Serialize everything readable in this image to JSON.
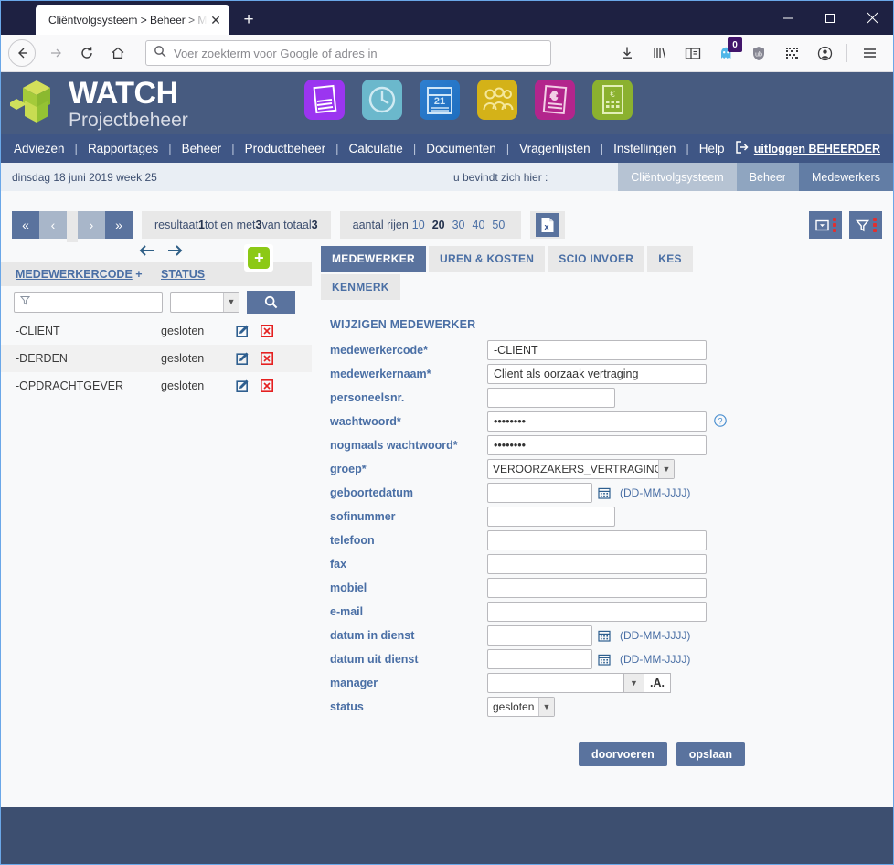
{
  "browser": {
    "tab_title": "Cliëntvolgsysteem > Beheer > Med",
    "close_tab": "✕",
    "new_tab": "+",
    "minimize": "—",
    "maximize": "▢",
    "close_window": "✕",
    "url_placeholder": "Voer zoekterm voor Google of adres in",
    "url_value": "",
    "container_badge": "0"
  },
  "brand": {
    "name": "WATCH",
    "subtitle": "Projectbeheer",
    "app_icons": [
      "documents-icon",
      "clock-icon",
      "calendar-21-icon",
      "people-icon",
      "euro-invoice-icon",
      "calculator-icon"
    ]
  },
  "menu": {
    "items": [
      "Adviezen",
      "Rapportages",
      "Beheer",
      "Productbeheer",
      "Calculatie",
      "Documenten",
      "Vragenlijsten",
      "Instellingen",
      "Help"
    ],
    "separator": "|",
    "logout_label": "uitloggen BEHEERDER"
  },
  "breadcrumb": {
    "date": "dinsdag 18 juni 2019   week 25",
    "here_label": "u bevindt zich hier :",
    "items": [
      "Cliëntvolgsysteem",
      "Beheer",
      "Medewerkers"
    ]
  },
  "toolbar": {
    "first": "«",
    "prev": "‹",
    "next": "›",
    "last": "»",
    "result_prefix": "resultaat ",
    "result_from": "1",
    "result_mid": " tot en met ",
    "result_to": "3",
    "result_suffix": " van totaal ",
    "result_total": "3",
    "rows_label": "aantal rijen",
    "row_options": [
      "10",
      "20",
      "30",
      "40",
      "50"
    ],
    "rows_selected": "20",
    "export_icon": "excel-export-icon",
    "columns_icon": "column-chooser-icon",
    "filter_icon": "filter-icon"
  },
  "list": {
    "move_left": "←",
    "move_right": "→",
    "add_label": "+",
    "columns": [
      "MEDEWERKERCODE",
      "STATUS"
    ],
    "sort_marker": "+",
    "filter_placeholder": "",
    "status_filter_value": "",
    "search_label": "search-icon",
    "rows": [
      {
        "code": "-CLIENT",
        "status": "gesloten"
      },
      {
        "code": "-DERDEN",
        "status": "gesloten"
      },
      {
        "code": "-OPDRACHTGEVER",
        "status": "gesloten"
      }
    ]
  },
  "form": {
    "tabs": [
      "MEDEWERKER",
      "UREN & KOSTEN",
      "SCIO INVOER",
      "KES",
      "KENMERK"
    ],
    "active_tab": "MEDEWERKER",
    "title": "WIJZIGEN MEDEWERKER",
    "date_hint": "(DD-MM-JJJJ)",
    "fields": [
      {
        "label": "medewerkercode*",
        "value": "-CLIENT"
      },
      {
        "label": "medewerkernaam*",
        "value": "Client als oorzaak vertraging"
      },
      {
        "label": "personeelsnr.",
        "value": ""
      },
      {
        "label": "wachtwoord*",
        "value": "••••••••"
      },
      {
        "label": "nogmaals wachtwoord*",
        "value": "••••••••"
      },
      {
        "label": "groep*",
        "value": "VEROORZAKERS_VERTRAGING"
      },
      {
        "label": "geboortedatum",
        "value": ""
      },
      {
        "label": "sofinummer",
        "value": ""
      },
      {
        "label": "telefoon",
        "value": ""
      },
      {
        "label": "fax",
        "value": ""
      },
      {
        "label": "mobiel",
        "value": ""
      },
      {
        "label": "e-mail",
        "value": ""
      },
      {
        "label": "datum in dienst",
        "value": ""
      },
      {
        "label": "datum uit dienst",
        "value": ""
      },
      {
        "label": "manager",
        "value": ""
      },
      {
        "label": "status",
        "value": "gesloten"
      }
    ],
    "manager_suffix": ".A.",
    "buttons": {
      "apply": "doorvoeren",
      "save": "opslaan"
    }
  },
  "colors": {
    "titlebar": "#1e2142",
    "brandbar": "#475b80",
    "menubar": "#3f5685",
    "accent": "#5a739e",
    "label": "#4a6fa5",
    "footer": "#3d4f70",
    "add_green": "#8cc916",
    "delete_red": "#e03030"
  }
}
